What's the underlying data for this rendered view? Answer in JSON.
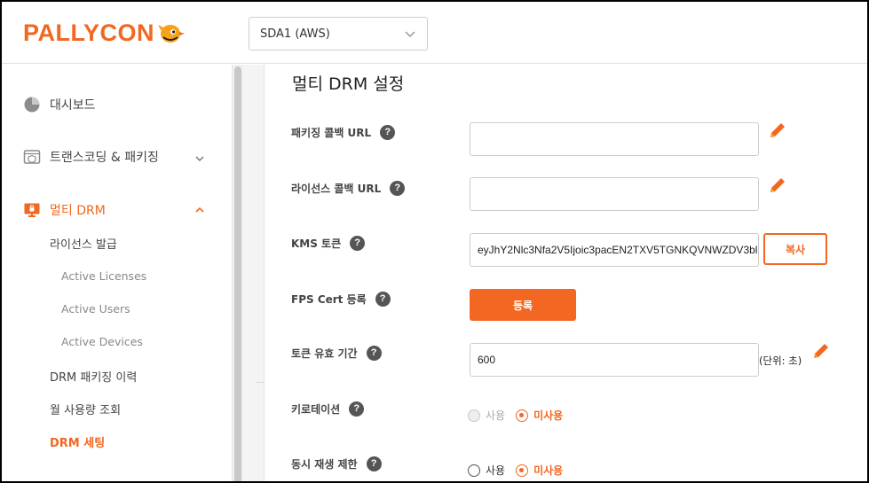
{
  "header": {
    "logo_text": "PALLYCON",
    "project_selected": "SDA1 (AWS)"
  },
  "sidebar": {
    "items": [
      {
        "label": "대시보드",
        "icon": "pie-chart-icon"
      },
      {
        "label": "트랜스코딩 & 패키징",
        "icon": "transcode-icon"
      },
      {
        "label": "멀티 DRM",
        "icon": "monitor-lock-icon"
      }
    ],
    "sub_items": [
      {
        "label": "라이선스 발급"
      },
      {
        "label": "Active Licenses"
      },
      {
        "label": "Active Users"
      },
      {
        "label": "Active Devices"
      },
      {
        "label": "DRM 패키징 이력"
      },
      {
        "label": "월 사용량 조회"
      },
      {
        "label": "DRM 세팅"
      }
    ]
  },
  "main": {
    "title": "멀티 DRM 설정",
    "help_glyph": "?",
    "fields": {
      "packaging_callback": {
        "label": "패키징 콜백 URL",
        "value": ""
      },
      "license_callback": {
        "label": "라이선스 콜백 URL",
        "value": ""
      },
      "kms_token": {
        "label": "KMS 토큰",
        "value": "eyJhY2Nlc3Nfa2V5Ijoic3pacEN2TXV5TGNKQVNWZDV3bl",
        "copy_label": "복사"
      },
      "fps_cert": {
        "label": "FPS Cert 등록",
        "button_label": "등록"
      },
      "token_ttl": {
        "label": "토큰 유효 기간",
        "value": "600",
        "unit": "(단위: 초)"
      },
      "key_rotation": {
        "label": "키로테이션",
        "option_use": "사용",
        "option_not_use": "미사용"
      },
      "concurrent_limit": {
        "label": "동시 재생 제한",
        "option_use": "사용",
        "option_not_use": "미사용"
      }
    }
  },
  "colors": {
    "accent": "#f26722"
  }
}
